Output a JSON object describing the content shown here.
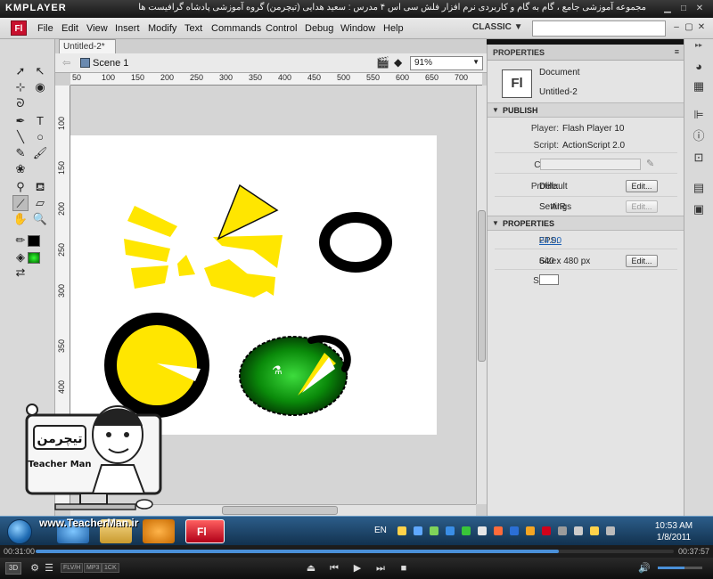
{
  "player": {
    "logo": "KMPLAYER",
    "title": "مجموعه آموزشی جامع ، گام به گام و کاربردی نرم افزار فلش سی اس ۴ مدرس : سعید هدایی (تیچرمن) گروه آموزشی پادشاه گرافیست ها",
    "time_elapsed": "00:31:00",
    "time_total": "00:37:57",
    "progress": 0.82,
    "volume": 0.6,
    "badges": [
      "FLV/H",
      "MP3",
      "1CK"
    ]
  },
  "flash": {
    "app_logo": "Fl",
    "menu": [
      "File",
      "Edit",
      "View",
      "Insert",
      "Modify",
      "Text",
      "Commands",
      "Control",
      "Debug",
      "Window",
      "Help"
    ],
    "workspace": "CLASSIC ▼",
    "doc_tab": "Untitled-2*",
    "scene": "Scene 1",
    "zoom": "91%",
    "ruler_h": [
      "50",
      "100",
      "150",
      "200",
      "250",
      "300",
      "350",
      "400",
      "450",
      "500",
      "550",
      "600",
      "650",
      "700"
    ],
    "ruler_v": [
      "100",
      "150",
      "200",
      "250",
      "300",
      "350",
      "400"
    ]
  },
  "properties": {
    "tab": "PROPERTIES",
    "doc_icon": "Fl",
    "doc_type": "Document",
    "doc_name": "Untitled-2",
    "publish_header": "PUBLISH",
    "player_label": "Player:",
    "player_value": "Flash Player 10",
    "script_label": "Script:",
    "script_value": "ActionScript 2.0",
    "class_label": "Class:",
    "profile_label": "Profile:",
    "profile_value": "Default",
    "edit_label": "Edit...",
    "air_label": "AIR",
    "air_value": "Settings",
    "properties_header": "PROPERTIES",
    "fps_label": "FPS:",
    "fps_value": "24.00",
    "size_label": "Size:",
    "size_value": "640 x 480 px",
    "stage_label": "Stage:"
  },
  "taskbar": {
    "lang": "EN",
    "time": "10:53 AM",
    "date": "1/8/2011"
  },
  "overlay": {
    "logo_text": "تیچرمن",
    "logo_sub": "Teacher Man",
    "url": "www.TeacherMan.ir"
  },
  "colors": {
    "yellow": "#FFE600",
    "black": "#000000",
    "green": "#00A000",
    "fl_red": "#C8102E",
    "taskbar": "#1F4A72"
  }
}
